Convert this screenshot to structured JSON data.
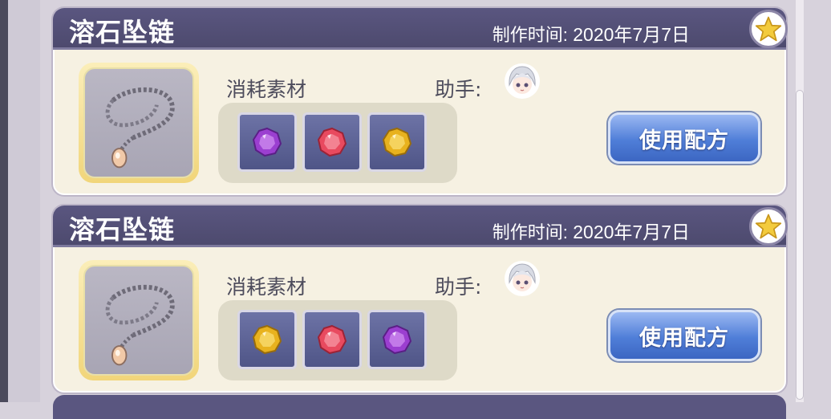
{
  "recipes": [
    {
      "title": "溶石坠链",
      "date_label": "制作时间:",
      "date_value": "2020年7月7日",
      "materials_label": "消耗素材",
      "helper_label": "助手:",
      "use_button": "使用配方",
      "materials": [
        "purple-gem",
        "red-gem",
        "yellow-gem"
      ]
    },
    {
      "title": "溶石坠链",
      "date_label": "制作时间:",
      "date_value": "2020年7月7日",
      "materials_label": "消耗素材",
      "helper_label": "助手:",
      "use_button": "使用配方",
      "materials": [
        "yellow-gem",
        "red-gem",
        "purple-gem"
      ]
    }
  ],
  "colors": {
    "header": "#5a5680",
    "card": "#f6f1e2",
    "button": "#4f7ed8",
    "purple_gem": "#9b3fd0",
    "red_gem": "#e84a5f",
    "yellow_gem": "#e8b21e"
  },
  "icons": {
    "favorite": "star-icon",
    "item": "pendant-necklace-icon",
    "helper": "helper-avatar-icon"
  }
}
